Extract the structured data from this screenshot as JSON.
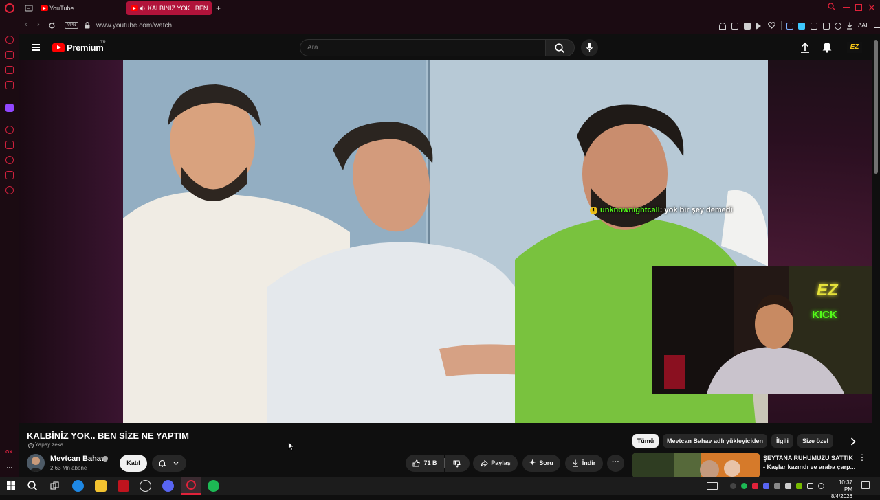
{
  "browser": {
    "tabs": [
      {
        "label": "YouTube",
        "active": false
      },
      {
        "label": "KALBİNİZ YOK.. BEN Sİ",
        "active": true
      }
    ],
    "new_tab": "+",
    "url": "www.youtube.com/watch",
    "vpn_label": "VPN",
    "ai_label": "AI"
  },
  "youtube": {
    "logo_text": "Premium",
    "logo_region": "TR",
    "search_placeholder": "Ara",
    "profile_badge": "EZ"
  },
  "video": {
    "chat_user": "unknownightcall",
    "chat_message": ": yok bir şey demedi",
    "webcam_sign_top": "EZ",
    "webcam_sign_bottom": "KICK"
  },
  "watch": {
    "title": "KALBİNİZ YOK.. BEN SİZE NE YAPTIM",
    "ai_tag": "Yapay zeka",
    "channel_name": "Mevtcan Bahav",
    "subscribers": "2,63 Mn abone",
    "join_label": "Katıl",
    "likes": "71 B",
    "share_label": "Paylaş",
    "ask_label": "Soru",
    "download_label": "İndir",
    "more_label": "···"
  },
  "chips": [
    {
      "label": "Tümü",
      "active": true
    },
    {
      "label": "Mevtcan Bahav adlı yükleyiciden",
      "active": false
    },
    {
      "label": "İlgili",
      "active": false
    },
    {
      "label": "Size özel",
      "active": false
    }
  ],
  "recommendation": {
    "title_line1": "ŞEYTANA RUHUMUZU SATTIK",
    "title_line2": "- Kaşlar kazındı ve araba çarp..."
  },
  "taskbar": {
    "time": "10:37 PM",
    "date": "8/4/2026"
  },
  "colors": {
    "opera_red": "#e0223a",
    "active_tab": "#b0133a",
    "chat_user": "#53fc18",
    "yt_red": "#ff0000"
  }
}
